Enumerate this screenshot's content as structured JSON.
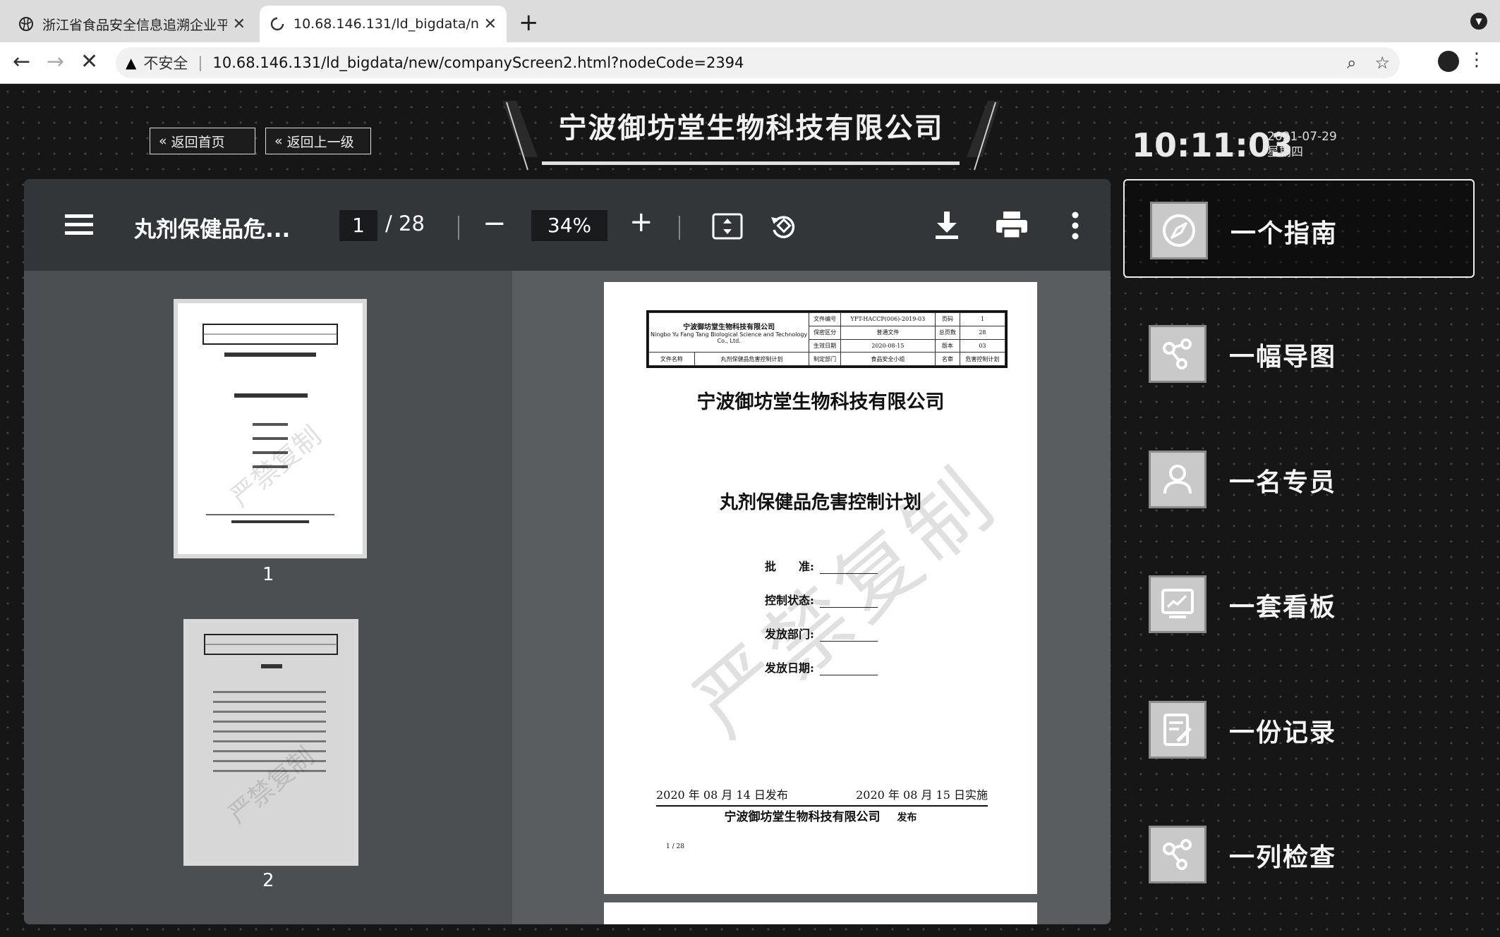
{
  "browser": {
    "tabs": [
      {
        "title": "浙江省食品安全信息追溯企业平台",
        "active": false
      },
      {
        "title": "10.68.146.131/ld_bigdata/new/",
        "active": true
      }
    ],
    "new_tab": "+",
    "security_label": "不安全",
    "url": "10.68.146.131/ld_bigdata/new/companyScreen2.html?nodeCode=2394"
  },
  "header": {
    "back_home": "返回首页",
    "back_up": "返回上一级",
    "company_title": "宁波御坊堂生物科技有限公司",
    "time": "10:11:03",
    "date": "2021-07-29",
    "weekday": "星期四"
  },
  "pdf_viewer": {
    "doc_title": "丸剂保健品危...",
    "current_page": "1",
    "total_pages": "/ 28",
    "zoom": "34%",
    "thumbnails": [
      {
        "label": "1"
      },
      {
        "label": "2"
      }
    ]
  },
  "document": {
    "header_table": {
      "company_cn": "宁波御坊堂生物科技有限公司",
      "company_en": "Ningbo Yu Fang Tang Biological Science and Technology Co., Ltd.",
      "file_name_label": "文件名称",
      "file_name": "丸剂保健品危害控制计划",
      "doc_no_label": "文件编号",
      "doc_no": "YFT-HACCP(006)-2019-03",
      "page_label": "页码",
      "page": "1",
      "security_label": "保密区分",
      "security": "普通文件",
      "total_label": "总页数",
      "total": "28",
      "issue_label": "生效日期",
      "issue_date": "2020-08-15",
      "version_label": "版本",
      "version": "03",
      "dept_label": "制定部门",
      "dept": "食品安全小组",
      "review_label": "名审",
      "review": "危害控制计划"
    },
    "company": "宁波御坊堂生物科技有限公司",
    "plan_title": "丸剂保健品危害控制计划",
    "approve_label": "批　　准:",
    "status_label": "控制状态:",
    "dept_label": "发放部门:",
    "date_label": "发放日期:",
    "publish_date": "2020 年 08 月 14 日发布",
    "effective_date": "2020 年 08 月 15 日实施",
    "issuer": "宁波御坊堂生物科技有限公司",
    "issuer_suffix": "发布",
    "page_number": "1 / 28",
    "watermark": "严禁复制"
  },
  "side_nav": [
    {
      "label": "一个指南",
      "icon": "compass-icon",
      "active": true
    },
    {
      "label": "一幅导图",
      "icon": "share-nodes-icon",
      "active": false
    },
    {
      "label": "一名专员",
      "icon": "person-icon",
      "active": false
    },
    {
      "label": "一套看板",
      "icon": "dashboard-chart-icon",
      "active": false
    },
    {
      "label": "一份记录",
      "icon": "record-edit-icon",
      "active": false
    },
    {
      "label": "一列检查",
      "icon": "share-nodes-icon",
      "active": false
    }
  ]
}
